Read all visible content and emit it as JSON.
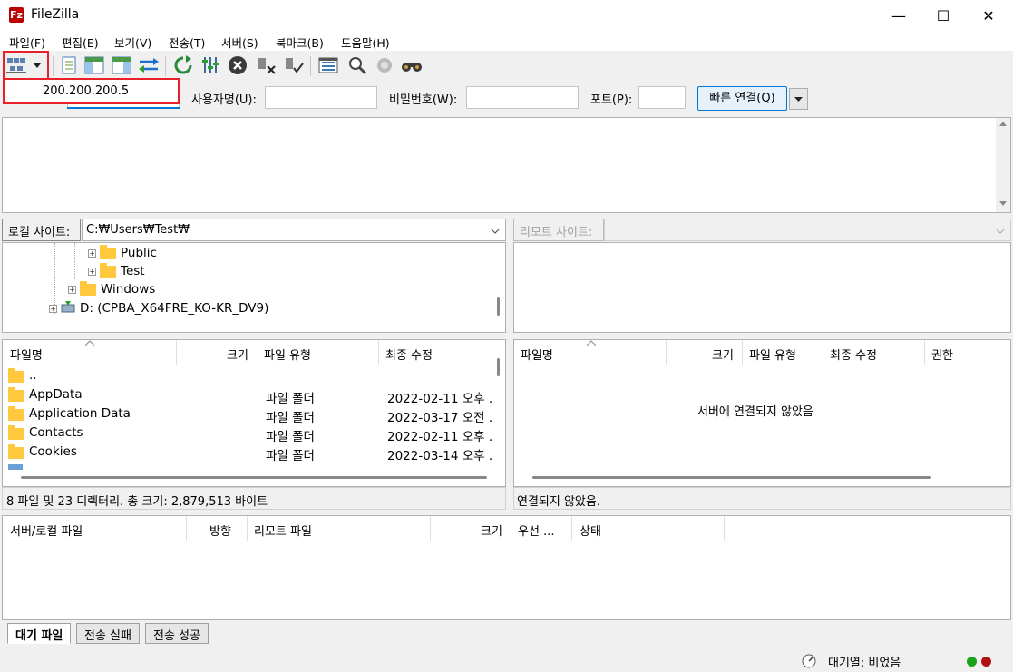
{
  "window": {
    "title": "FileZilla",
    "app_icon_glyph": "Fz",
    "minimize_glyph": "—",
    "maximize_glyph": "☐",
    "close_glyph": "✕"
  },
  "menu": [
    "파일(F)",
    "편집(E)",
    "보기(V)",
    "전송(T)",
    "서버(S)",
    "북마크(B)",
    "도움말(H)"
  ],
  "site_manager": {
    "dropdown_item": "200.200.200.5",
    "highlight_color": "#e8202a"
  },
  "quickconnect": {
    "user_label": "사용자명(U):",
    "user_value": "",
    "password_label": "비밀번호(W):",
    "password_value": "",
    "port_label": "포트(P):",
    "port_value": "",
    "connect_button": "빠른 연결(Q)"
  },
  "local": {
    "site_label": "로컬 사이트:",
    "path": "C:₩Users₩Test₩",
    "tree": [
      {
        "label": "Public"
      },
      {
        "label": "Test"
      },
      {
        "label": "Windows"
      },
      {
        "label": "D: (CPBA_X64FRE_KO-KR_DV9)"
      }
    ],
    "columns": [
      "파일명",
      "크기",
      "파일 유형",
      "최종 수정"
    ],
    "files": [
      {
        "name": "..",
        "type": "",
        "date": ""
      },
      {
        "name": "AppData",
        "type": "파일 폴더",
        "date": "2022-02-11 오후 ."
      },
      {
        "name": "Application Data",
        "type": "파일 폴더",
        "date": "2022-03-17 오전 ."
      },
      {
        "name": "Contacts",
        "type": "파일 폴더",
        "date": "2022-02-11 오후 ."
      },
      {
        "name": "Cookies",
        "type": "파일 폴더",
        "date": "2022-03-14 오후 ."
      }
    ],
    "status": "8 파일 및 23 디렉터리. 총 크기: 2,879,513 바이트"
  },
  "remote": {
    "site_label": "리모트 사이트:",
    "path": "",
    "columns": [
      "파일명",
      "크기",
      "파일 유형",
      "최종 수정",
      "권한"
    ],
    "empty_message": "서버에 연결되지 않았음",
    "status": "연결되지 않았음."
  },
  "queue": {
    "columns": [
      "서버/로컬 파일",
      "방향",
      "리모트 파일",
      "크기",
      "우선 ...",
      "상태"
    ],
    "tabs": [
      "대기 파일",
      "전송 실패",
      "전송 성공"
    ],
    "status": "대기열: 비었음"
  },
  "colors": {
    "accent_red": "#e8202a",
    "folder_yellow": "#ffc83d",
    "status_green": "#1aa31a",
    "status_red": "#b01010"
  }
}
